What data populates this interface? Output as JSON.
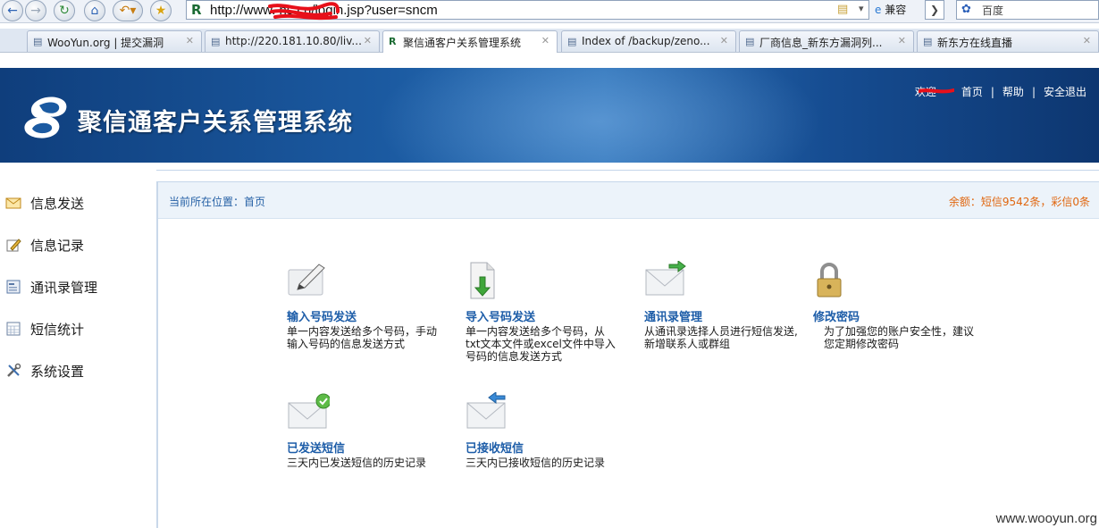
{
  "browser": {
    "url": "http://www.           ns.cn/login.jsp?user=sncm",
    "compat_label": "兼容",
    "search_placeholder": "百度"
  },
  "tabs": [
    {
      "label": "WooYun.org | 提交漏洞"
    },
    {
      "label": "http://220.181.10.80/liv..."
    },
    {
      "label": "聚信通客户关系管理系统",
      "active": true
    },
    {
      "label": "Index of /backup/zeno..."
    },
    {
      "label": "厂商信息_新东方漏洞列..."
    },
    {
      "label": "新东方在线直播"
    }
  ],
  "header": {
    "title": "聚信通客户关系管理系统",
    "welcome": "欢迎",
    "home": "首页",
    "help": "帮助",
    "logout": "安全退出",
    "sep": "|"
  },
  "sidebar": {
    "items": [
      {
        "label": "信息发送",
        "icon": "envelope-icon"
      },
      {
        "label": "信息记录",
        "icon": "edit-icon"
      },
      {
        "label": "通讯录管理",
        "icon": "addressbook-icon"
      },
      {
        "label": "短信统计",
        "icon": "calendar-icon"
      },
      {
        "label": "系统设置",
        "icon": "tools-icon"
      }
    ]
  },
  "main": {
    "location": "当前所在位置：首页",
    "balance": "余额：短信9542条，彩信0条",
    "cards": [
      {
        "title": "输入号码发送",
        "desc": "单一内容发送给多个号码，手动输入号码的信息发送方式",
        "icon": "pencil-note-icon"
      },
      {
        "title": "导入号码发送",
        "desc": "单一内容发送给多个号码，从txt文本文件或excel文件中导入号码的信息发送方式",
        "icon": "import-file-icon"
      },
      {
        "title": "通讯录管理",
        "desc": "从通讯录选择人员进行短信发送,新增联系人或群组",
        "icon": "envelope-forward-icon"
      },
      {
        "title": "修改密码",
        "desc": "为了加强您的账户安全性，建议您定期修改密码",
        "icon": "padlock-icon"
      },
      {
        "title": "已发送短信",
        "desc": "三天内已发送短信的历史记录",
        "icon": "envelope-sent-icon"
      },
      {
        "title": "已接收短信",
        "desc": "三天内已接收短信的历史记录",
        "icon": "envelope-received-icon"
      }
    ]
  },
  "watermark": "www.wooyun.org",
  "colors": {
    "header_blue": "#1b5aa1",
    "link_blue": "#1d5da8",
    "balance_orange": "#e0660f",
    "redaction": "#e8101a"
  }
}
